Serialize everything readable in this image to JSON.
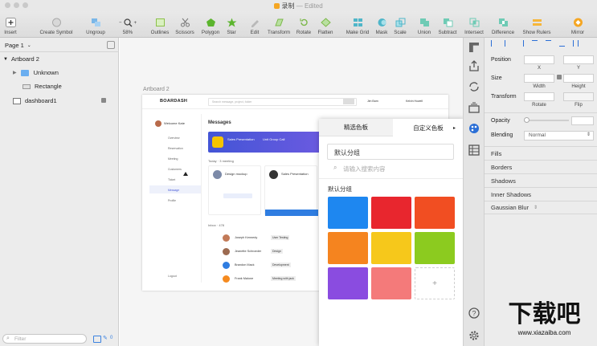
{
  "window": {
    "title": "录制",
    "status": "— Edited"
  },
  "toolbar": {
    "items": [
      {
        "label": "Insert"
      },
      {
        "label": "Create Symbol"
      },
      {
        "label": "Ungroup"
      },
      {
        "label": "58%"
      },
      {
        "label": "Outlines"
      },
      {
        "label": "Scissors"
      },
      {
        "label": "Polygon"
      },
      {
        "label": "Star"
      },
      {
        "label": "Edit"
      },
      {
        "label": "Transform"
      },
      {
        "label": "Rotate"
      },
      {
        "label": "Flatten"
      },
      {
        "label": "Make Grid"
      },
      {
        "label": "Mask"
      },
      {
        "label": "Scale"
      },
      {
        "label": "Union"
      },
      {
        "label": "Subtract"
      },
      {
        "label": "Intersect"
      },
      {
        "label": "Difference"
      },
      {
        "label": "Show Rulers"
      },
      {
        "label": "Mirror"
      }
    ],
    "zoom_minus": "−",
    "zoom_plus": "+"
  },
  "layers": {
    "page": "Page 1",
    "artboard": "Artboard 2",
    "items": [
      "Unknown",
      "Rectangle",
      "dashboard1"
    ],
    "filter_placeholder": "Filter",
    "badge": "0"
  },
  "canvas": {
    "artboard_label": "Artboard 2",
    "app": {
      "logo": "BOARDASH",
      "search": "Search message, project, folder",
      "user1": "Jim Barn",
      "user2": "Kelvin Howell",
      "welcome": "Welcome Kate",
      "nav": [
        "Overview",
        "Reservation",
        "Meeting",
        "Customers",
        "Ticket",
        "Message",
        "Profile",
        "Logout"
      ],
      "messages_title": "Messages",
      "banner_title": "Sales Presentation",
      "banner_sub": "Unit Group Call",
      "today": "Today · 3 meeting",
      "card1": "Design mockup",
      "card2": "Sales Presentation",
      "inbox": "Inbox · 478",
      "rows": [
        {
          "name": "Joseph Kennedy",
          "tag": "User Testing"
        },
        {
          "name": "Jeanette Schroeder",
          "tag": "Design"
        },
        {
          "name": "Brandon Mack",
          "tag": "Development"
        },
        {
          "name": "Frank Malone",
          "tag": "Meeting with jack"
        }
      ]
    }
  },
  "palette": {
    "tab1": "精选色板",
    "tab2": "自定义色板",
    "group_input": "默认分组",
    "search_placeholder": "请输入搜索内容",
    "group_label": "默认分组",
    "add": "+",
    "swatches": [
      "#1e87f0",
      "#e8262e",
      "#f14e22",
      "#f5841f",
      "#f6c81b",
      "#8ccb1f",
      "#8a4ce0",
      "#f47a7a"
    ]
  },
  "inspector": {
    "position": "Position",
    "x": "X",
    "y": "Y",
    "size": "Size",
    "width": "Width",
    "height": "Height",
    "transform": "Transform",
    "rotate": "Rotate",
    "flip": "Flip",
    "opacity": "Opacity",
    "blending": "Blending",
    "blending_value": "Normal",
    "sections": [
      "Fills",
      "Borders",
      "Shadows",
      "Inner Shadows",
      "Gaussian Blur"
    ]
  },
  "watermark": {
    "text": "下载吧",
    "url": "www.xiazaiba.com"
  }
}
